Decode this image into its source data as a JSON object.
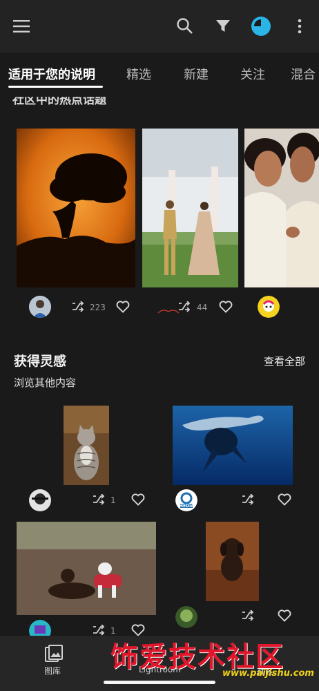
{
  "tabs": [
    {
      "label": "适用于您的说明",
      "active": true
    },
    {
      "label": "精选"
    },
    {
      "label": "新建"
    },
    {
      "label": "关注"
    },
    {
      "label": "混合"
    }
  ],
  "top_section": {
    "cut_title": "社区中的热点话题",
    "cards": [
      {
        "image": "tree-silhouette-photo",
        "remixes": "223"
      },
      {
        "image": "wedding-couple-photo",
        "remixes": "44"
      },
      {
        "image": "couple-portrait-photo"
      }
    ]
  },
  "inspire": {
    "title": "获得灵感",
    "subtitle": "浏览其他内容",
    "see_all": "查看全部",
    "cards": [
      {
        "image": "tabby-cat-photo",
        "remixes": "1"
      },
      {
        "image": "whale-underwater-photo",
        "avatar_text": "MEDIA"
      },
      {
        "image": "dogs-on-ground-photo",
        "remixes": "1"
      },
      {
        "image": "brown-puppy-photo"
      }
    ]
  },
  "bottom_nav": {
    "gallery": "图库",
    "lightroom": "Lightroom",
    "community": "社区"
  },
  "watermark": {
    "text": "饰爱技术社区",
    "url": "www.paijishu.com"
  },
  "colors": {
    "accent": "#2ab4e8",
    "background": "#1a1a1a",
    "watermark_red": "#e0162b"
  }
}
